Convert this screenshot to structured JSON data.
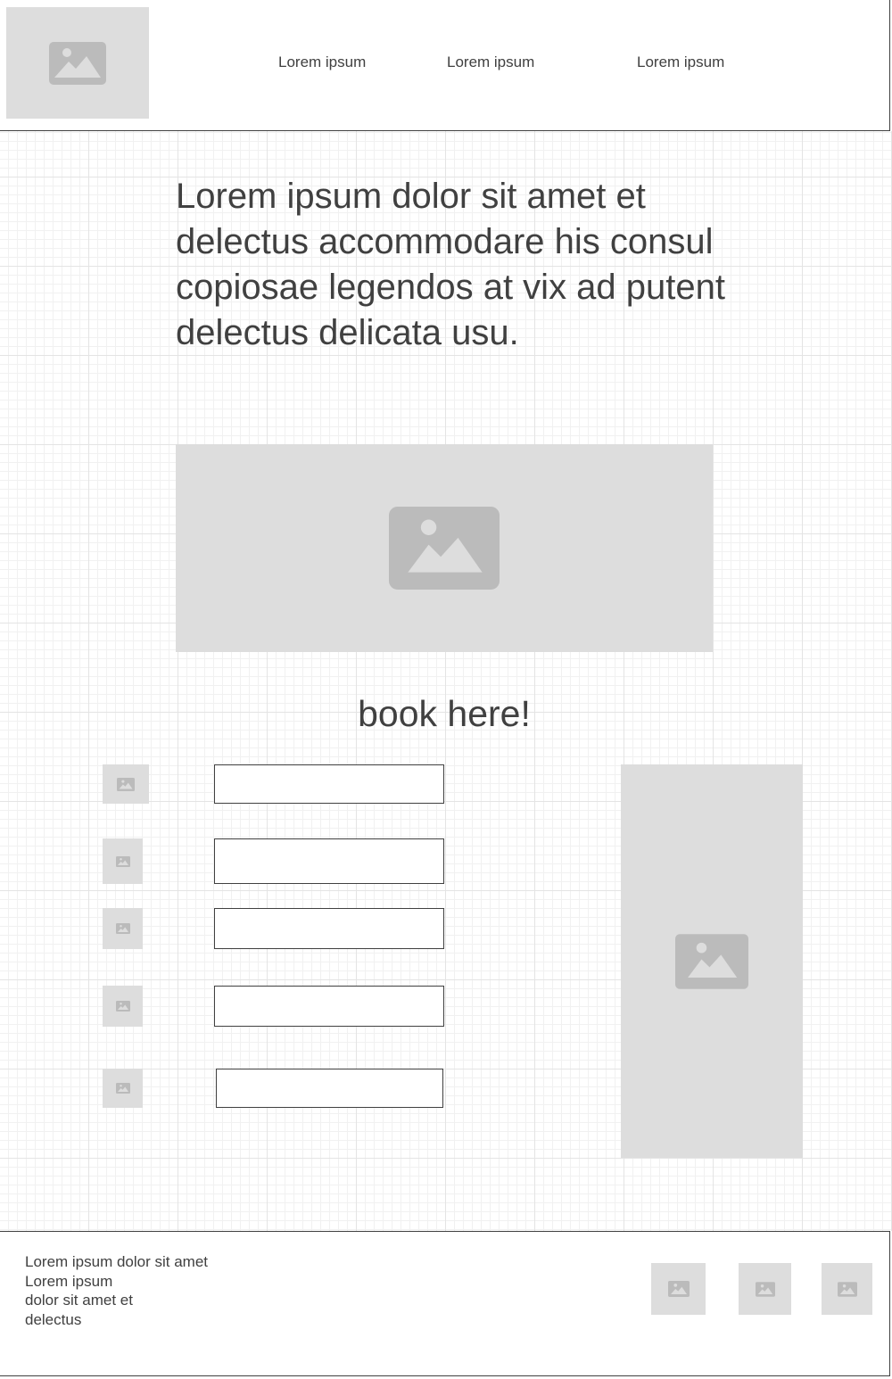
{
  "header": {
    "logo_icon": "image-placeholder-icon",
    "nav": [
      "Lorem ipsum",
      "Lorem ipsum",
      "Lorem ipsum"
    ]
  },
  "hero": {
    "text": "Lorem ipsum dolor sit amet et delectus accommodare his consul copiosae legendos at vix ad putent delectus delicata usu.",
    "image_icon": "image-placeholder-icon"
  },
  "booking": {
    "title": "book here!",
    "fields": [
      {
        "icon": "image-placeholder-icon",
        "value": ""
      },
      {
        "icon": "image-placeholder-icon",
        "value": ""
      },
      {
        "icon": "image-placeholder-icon",
        "value": ""
      },
      {
        "icon": "image-placeholder-icon",
        "value": ""
      },
      {
        "icon": "image-placeholder-icon",
        "value": ""
      }
    ],
    "side_image_icon": "image-placeholder-icon"
  },
  "footer": {
    "lines": [
      "Lorem ipsum dolor sit amet",
      "Lorem ipsum",
      "dolor sit amet et",
      "delectus"
    ],
    "social_icons": [
      "image-placeholder-icon",
      "image-placeholder-icon",
      "image-placeholder-icon"
    ]
  },
  "colors": {
    "text": "#404040",
    "placeholder_bg": "#dddddd",
    "placeholder_icon": "#bbbbbb",
    "border": "#404040"
  }
}
